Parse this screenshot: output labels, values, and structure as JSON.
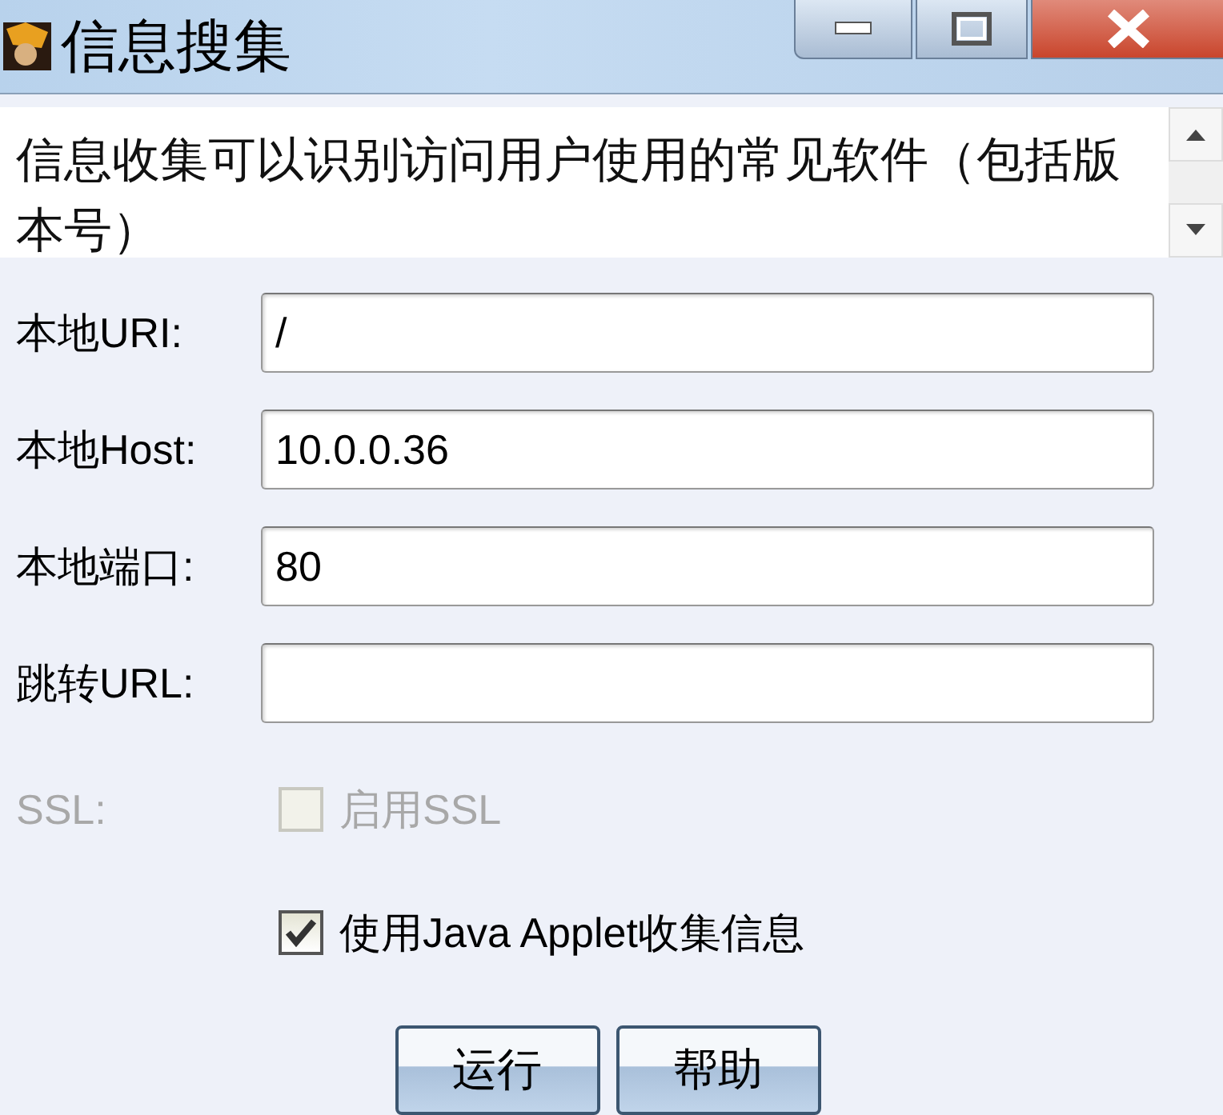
{
  "window": {
    "title": "信息搜集"
  },
  "description": "信息收集可以识别访问用户使用的常见软件（包括版本号）",
  "fields": [
    {
      "label": "本地URI:",
      "value": "/"
    },
    {
      "label": "本地Host:",
      "value": "10.0.0.36"
    },
    {
      "label": "本地端口:",
      "value": "80"
    },
    {
      "label": "跳转URL:"
    }
  ],
  "options": [
    {
      "label": "SSL:",
      "text": "启用SSL",
      "checked": false,
      "disabled": true
    },
    {
      "text": "使用Java Applet收集信息",
      "checked": true,
      "disabled": false
    }
  ],
  "buttons": [
    "运行",
    "帮助"
  ]
}
